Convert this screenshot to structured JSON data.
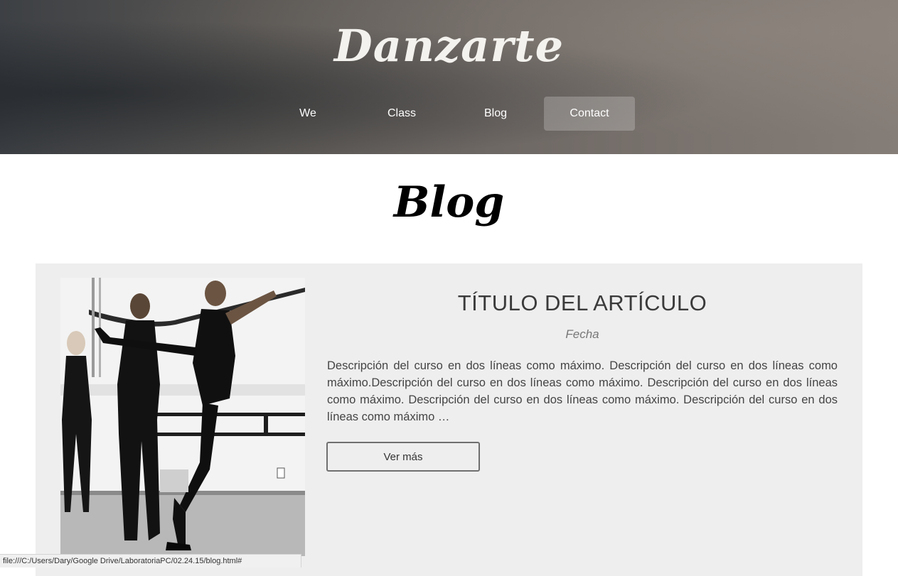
{
  "header": {
    "logo": "Danzarte",
    "nav": [
      {
        "label": "We",
        "active": false
      },
      {
        "label": "Class",
        "active": false
      },
      {
        "label": "Blog",
        "active": false
      },
      {
        "label": "Contact",
        "active": true
      }
    ]
  },
  "page": {
    "title": "Blog"
  },
  "article": {
    "image_alt": "dance-class-photo",
    "title": "TÍTULO DEL ARTÍCULO",
    "date": "Fecha",
    "description": "Descripción del curso en dos líneas como máximo. Descripción del curso en dos líneas como máximo.Descripción del curso en dos líneas como máximo. Descripción del curso en dos líneas como máximo. Descripción del curso en dos líneas como máximo. Descripción del curso en dos líneas como máximo …",
    "button_label": "Ver más"
  },
  "status_bar": {
    "url": "file:///C:/Users/Dary/Google Drive/LaboratoriaPC/02.24.15/blog.html#"
  },
  "colors": {
    "card_background": "#eeeeee",
    "nav_active_background": "rgba(255,255,255,0.22)"
  }
}
